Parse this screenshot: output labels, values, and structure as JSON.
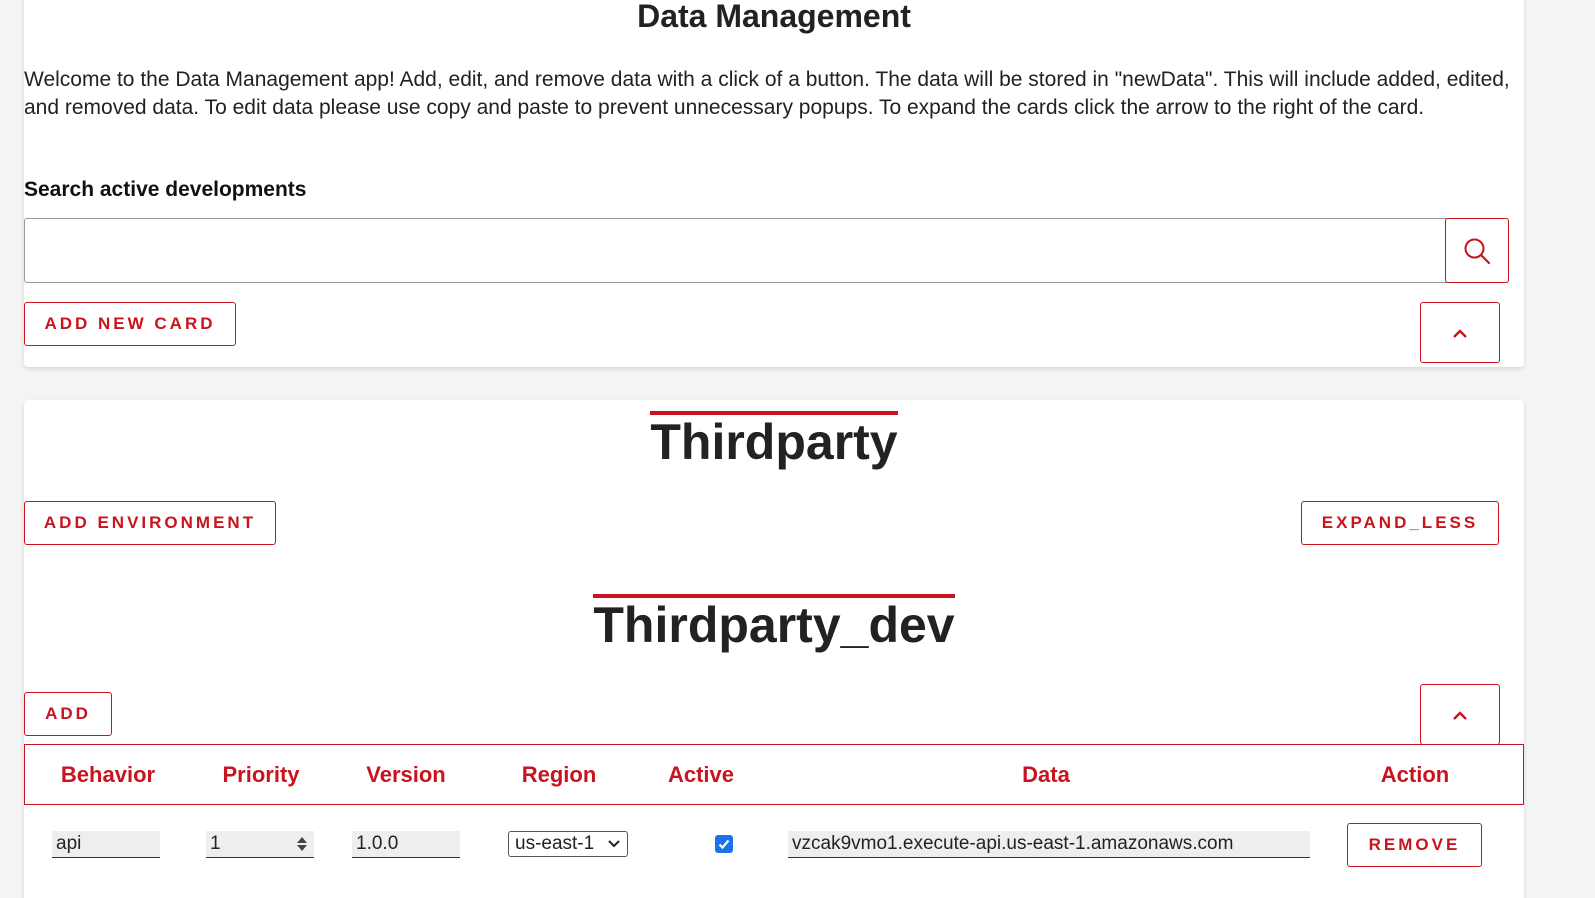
{
  "header": {
    "title": "Data Management",
    "intro": "Welcome to the Data Management app! Add, edit, and remove data with a click of a button. The data will be stored in \"newData\". This will include added, edited, and removed data. To edit data please use copy and paste to prevent unnecessary popups. To expand the cards click the arrow to the right of the card.",
    "search_label": "Search active developments",
    "search_value": "",
    "add_card_label": "ADD NEW CARD"
  },
  "card": {
    "title": "Thirdparty",
    "add_environment_label": "ADD ENVIRONMENT",
    "expand_less_label": "EXPAND_LESS",
    "environment": {
      "title": "Thirdparty_dev",
      "add_label": "ADD",
      "table": {
        "columns": [
          "Behavior",
          "Priority",
          "Version",
          "Region",
          "Active",
          "Data",
          "Action"
        ],
        "rows": [
          {
            "behavior": "api",
            "priority": "1",
            "version": "1.0.0",
            "region": "us-east-1",
            "active": true,
            "data": "vzcak9vmo1.execute-api.us-east-1.amazonaws.com",
            "action_label": "REMOVE"
          }
        ]
      }
    }
  },
  "colors": {
    "accent": "#c8141e",
    "checkbox": "#1a73e8",
    "background": "#f4f4f4"
  },
  "icons": [
    "search-icon",
    "chevron-up-icon",
    "chevron-down-icon",
    "checkmark-icon",
    "stepper-icon"
  ]
}
